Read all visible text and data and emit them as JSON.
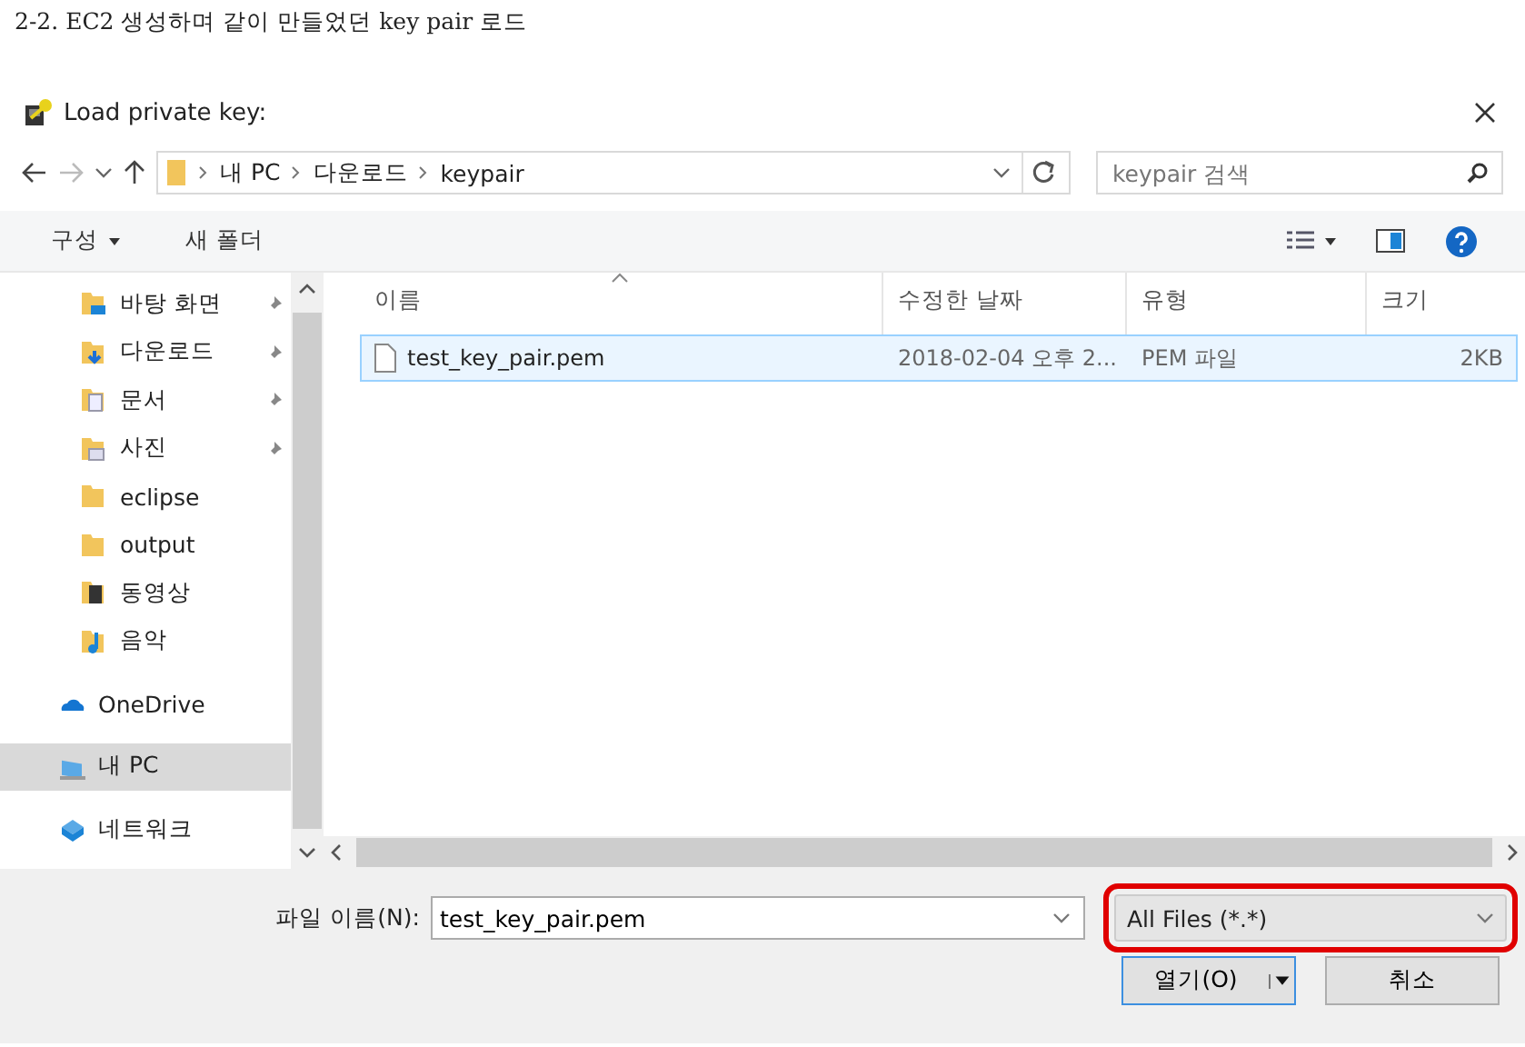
{
  "heading": "2-2. EC2 생성하며 같이 만들었던 key pair 로드",
  "window": {
    "title": "Load private key:"
  },
  "address": {
    "crumbs": [
      "내 PC",
      "다운로드",
      "keypair"
    ]
  },
  "search": {
    "placeholder": "keypair 검색"
  },
  "toolbar": {
    "organize": "구성",
    "new_folder": "새 폴더"
  },
  "sidebar": {
    "items": [
      {
        "label": "바탕 화면",
        "kind": "desktop",
        "pinned": true,
        "selected": false
      },
      {
        "label": "다운로드",
        "kind": "download",
        "pinned": true,
        "selected": false
      },
      {
        "label": "문서",
        "kind": "document",
        "pinned": true,
        "selected": false
      },
      {
        "label": "사진",
        "kind": "picture",
        "pinned": true,
        "selected": false
      },
      {
        "label": "eclipse",
        "kind": "folder",
        "pinned": false,
        "selected": false
      },
      {
        "label": "output",
        "kind": "folder",
        "pinned": false,
        "selected": false
      },
      {
        "label": "동영상",
        "kind": "video",
        "pinned": false,
        "selected": false
      },
      {
        "label": "음악",
        "kind": "music",
        "pinned": false,
        "selected": false
      },
      {
        "label": "OneDrive",
        "kind": "cloud",
        "pinned": false,
        "selected": false
      },
      {
        "label": "내 PC",
        "kind": "pc",
        "pinned": false,
        "selected": true
      },
      {
        "label": "네트워크",
        "kind": "network",
        "pinned": false,
        "selected": false
      }
    ]
  },
  "table": {
    "columns": [
      "이름",
      "수정한 날짜",
      "유형",
      "크기"
    ],
    "rows": [
      {
        "cells": [
          "test_key_pair.pem",
          "2018-02-04 오후 2...",
          "PEM 파일",
          "2KB"
        ],
        "selected": true
      }
    ]
  },
  "file_name": {
    "label": "파일 이름(N):",
    "value": "test_key_pair.pem"
  },
  "file_type": {
    "value": "All Files (*.*)",
    "highlighted": true
  },
  "buttons": [
    {
      "label": "열기(O)",
      "kind": "split"
    },
    {
      "label": "취소",
      "kind": "plain"
    }
  ]
}
